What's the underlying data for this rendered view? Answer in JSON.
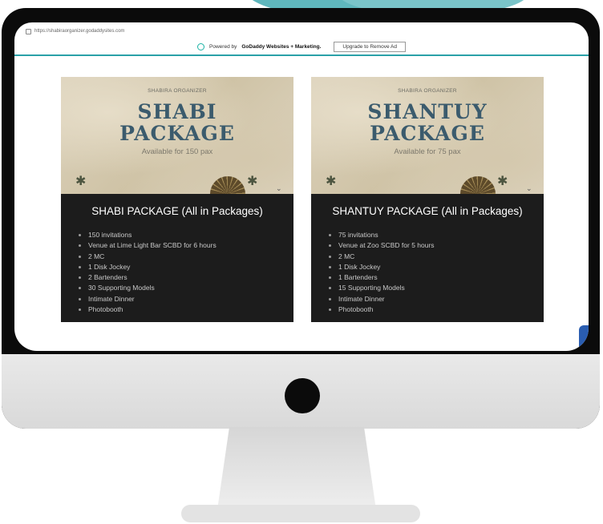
{
  "browser": {
    "url": "https://shabiraorganizer.godaddysites.com"
  },
  "adbar": {
    "powered_by": "Powered by",
    "brand": "GoDaddy Websites + Marketing.",
    "upgrade_label": "Upgrade to Remove Ad"
  },
  "cards": [
    {
      "organizer": "SHABIRA ORGANIZER",
      "title_line1": "SHABI",
      "title_line2": "PACKAGE",
      "availability": "Available for 150 pax",
      "heading": "SHABI PACKAGE (All in Packages)",
      "features": [
        "150 invitations",
        "Venue at Lime Light Bar SCBD for 6 hours",
        "2 MC",
        "1 Disk Jockey",
        "2 Bartenders",
        "30 Supporting Models",
        "Intimate Dinner",
        "Photobooth"
      ]
    },
    {
      "organizer": "SHABIRA ORGANIZER",
      "title_line1": "SHANTUY",
      "title_line2": "PACKAGE",
      "availability": "Available for 75 pax",
      "heading": "SHANTUY PACKAGE (All in Packages)",
      "features": [
        "75 invitations",
        "Venue at Zoo SCBD for 5 hours",
        "2 MC",
        "1 Disk Jockey",
        "1 Bartenders",
        "15 Supporting Models",
        "Intimate Dinner",
        "Photobooth"
      ]
    }
  ],
  "colors": {
    "accent_teal": "#2aa1a8",
    "poster_title": "#3b5b6d",
    "card_bg": "#1c1c1c"
  }
}
